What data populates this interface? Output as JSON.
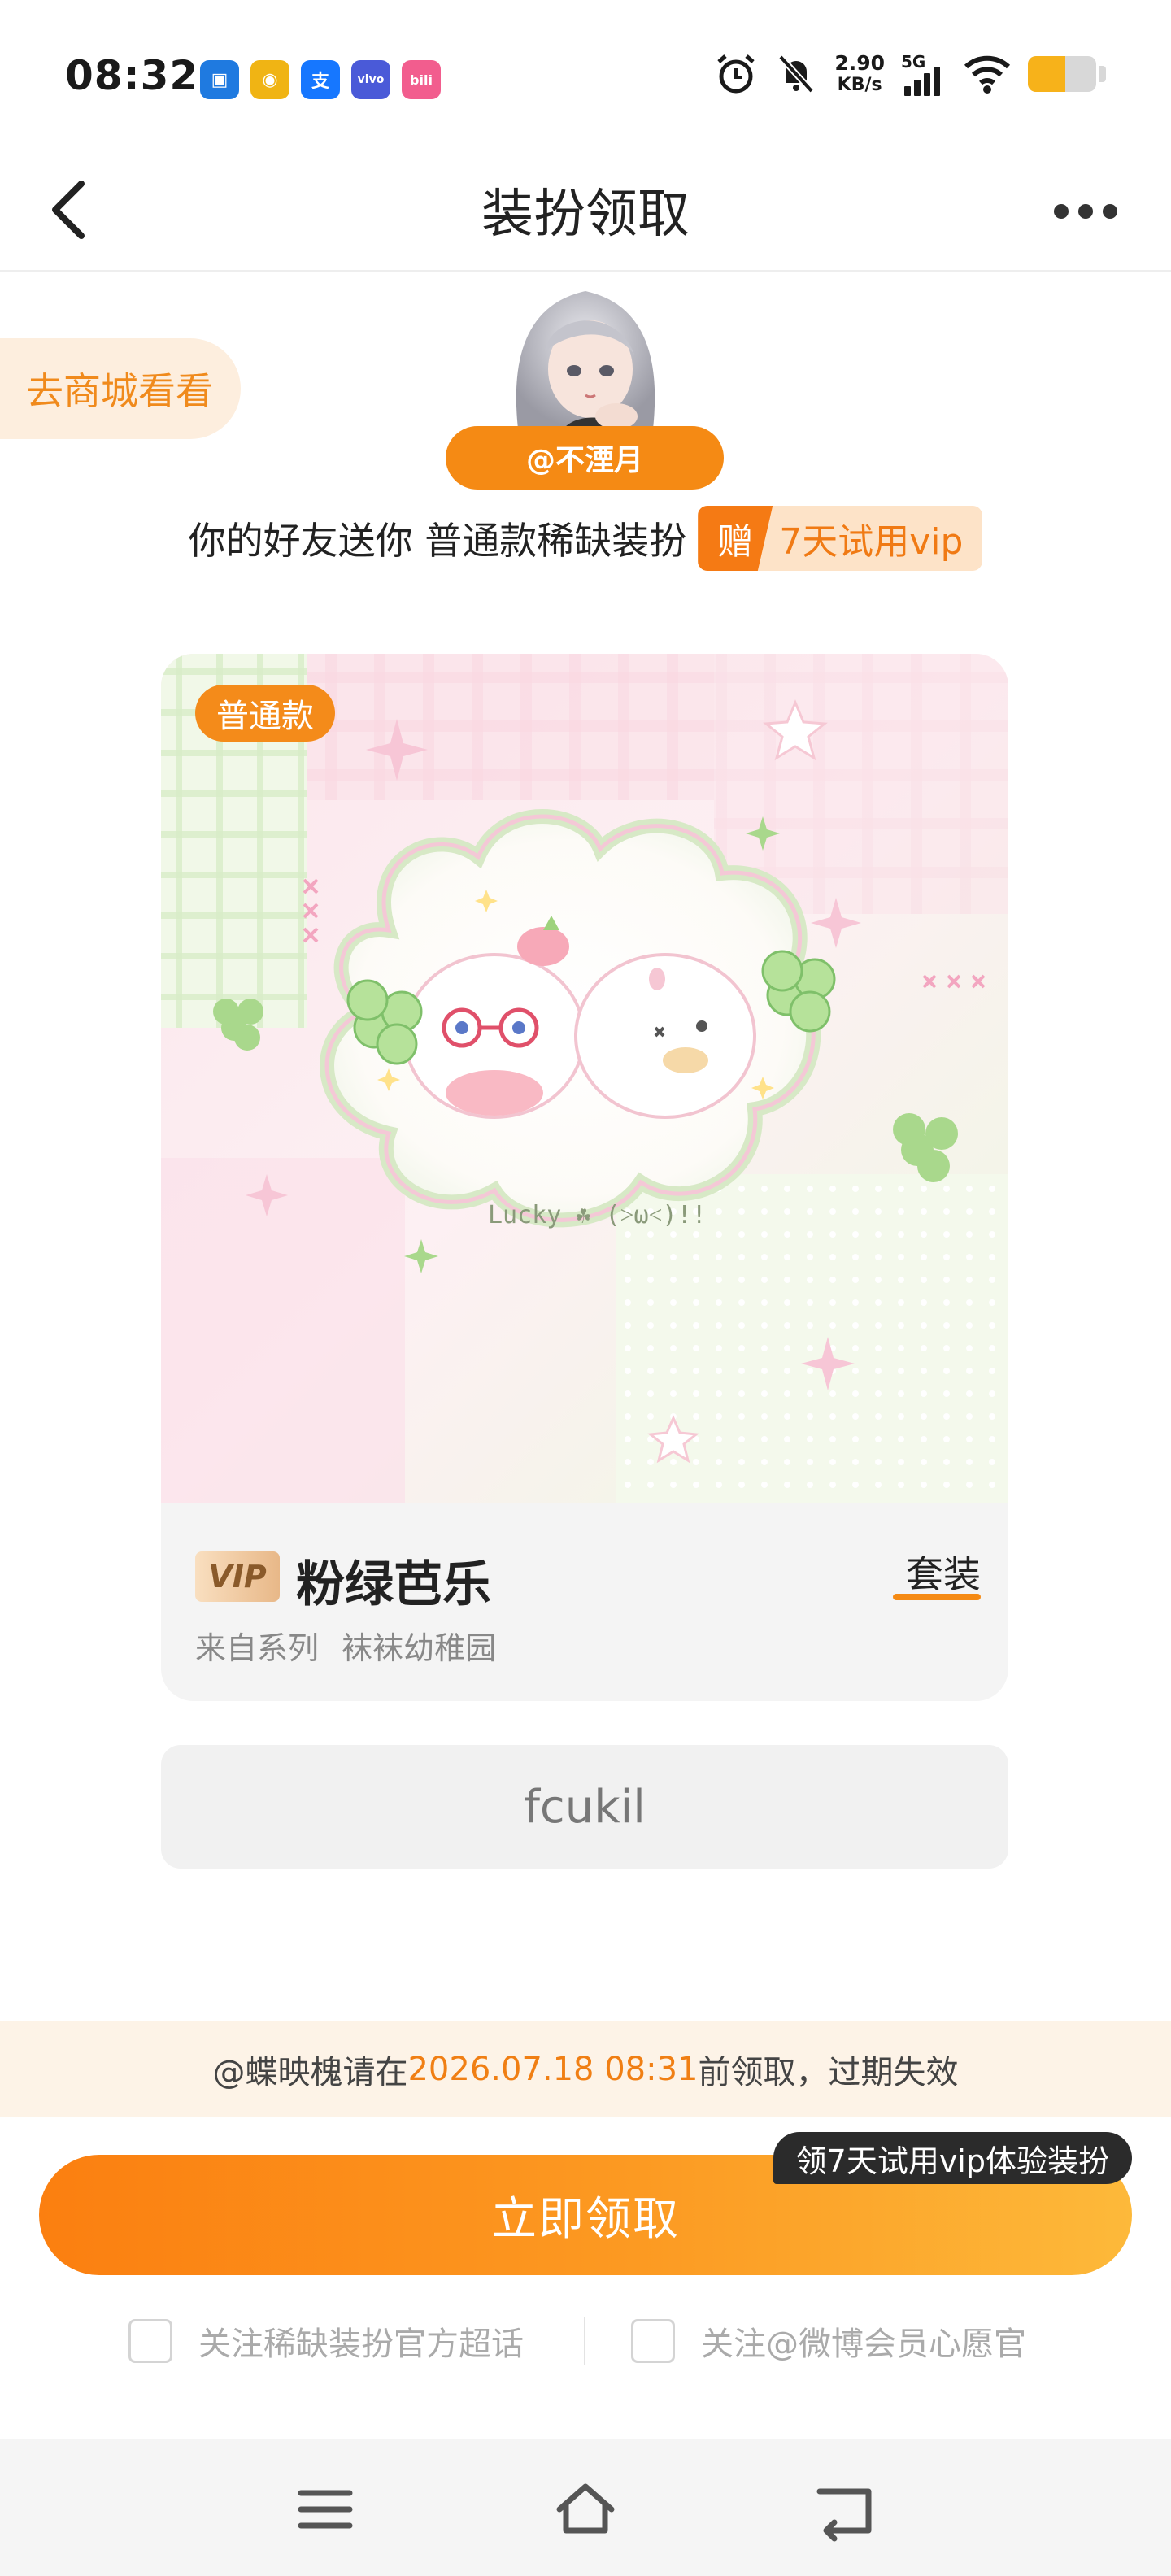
{
  "status_bar": {
    "time": "08:32",
    "app_icons": [
      {
        "name": "app-icon-blue",
        "glyph": "▣",
        "color": "#1f7ae0"
      },
      {
        "name": "weibo-icon",
        "glyph": "◉",
        "color": "#f0b414"
      },
      {
        "name": "alipay-icon",
        "glyph": "支",
        "color": "#1677ff"
      },
      {
        "name": "vivo-icon",
        "glyph": "vivo",
        "color": "#4a5ad8"
      },
      {
        "name": "bilibili-icon",
        "glyph": "bili",
        "color": "#f25d8e"
      }
    ],
    "net_speed_value": "2.90",
    "net_speed_unit": "KB/s",
    "network_type": "5G",
    "battery_level": 0.55
  },
  "nav": {
    "title": "装扮领取"
  },
  "header": {
    "shop_link": "去商城看看",
    "sender": "@不湮月",
    "gift_text": "你的好友送你 普通款稀缺装扮",
    "gift_badge_icon": "赠",
    "gift_badge_text": "7天试用vip"
  },
  "card": {
    "type_badge": "普通款",
    "vip_tag": "VIP",
    "name": "粉绿芭乐",
    "suit_link": "套装",
    "series": "来自系列 袜袜幼稚园",
    "art_caption": "Lucky ☘ (˃ω˂)!!"
  },
  "message": {
    "text": "fcukil"
  },
  "deadline": {
    "prefix": "@蝶映槐请在",
    "time": "2026.07.18 08:31",
    "suffix": "前领取，过期失效"
  },
  "claim": {
    "button_label": "立即领取",
    "tip": "领7天试用vip体验装扮"
  },
  "follow": {
    "option1": "关注稀缺装扮官方超话",
    "option2": "关注@微博会员心愿官"
  },
  "colors": {
    "accent": "#f58a14",
    "deadline_highlight": "#f07f14"
  }
}
